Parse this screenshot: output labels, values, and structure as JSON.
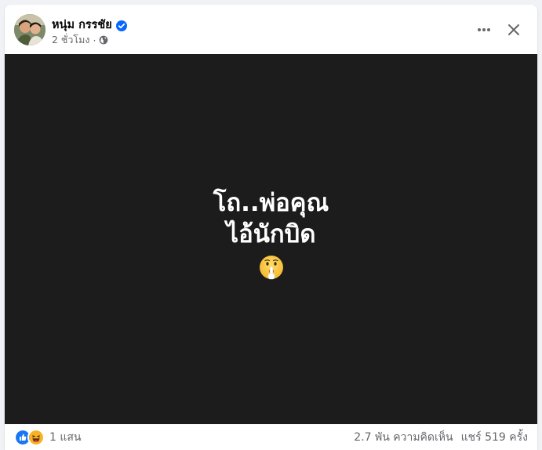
{
  "post": {
    "author": {
      "name": "หนุ่ม กรรชัย",
      "verified": true,
      "avatar_icon": "profile-photo"
    },
    "time": "2 ชั่วโมง",
    "separator": "·",
    "privacy_icon": "globe-icon",
    "content": {
      "line1": "โถ..พ่อคุณ",
      "line2": "ไอ้นักบิด",
      "emoji": "shushing-face-emoji",
      "background_color": "#1c1c1c",
      "text_color": "#ffffff"
    },
    "actions": {
      "more_icon": "more-horizontal-icon",
      "close_icon": "close-icon"
    },
    "engagement": {
      "reaction_icons": [
        "like-icon",
        "haha-icon"
      ],
      "reaction_count": "1 แสน",
      "comments": "2.7 พัน ความคิดเห็น",
      "shares": "แชร์ 519 ครั้ง"
    }
  },
  "colors": {
    "verified_blue": "#0866ff",
    "secondary_text": "#65676b",
    "like_blue": "#1877f2",
    "haha_yellow": "#f7b125"
  }
}
